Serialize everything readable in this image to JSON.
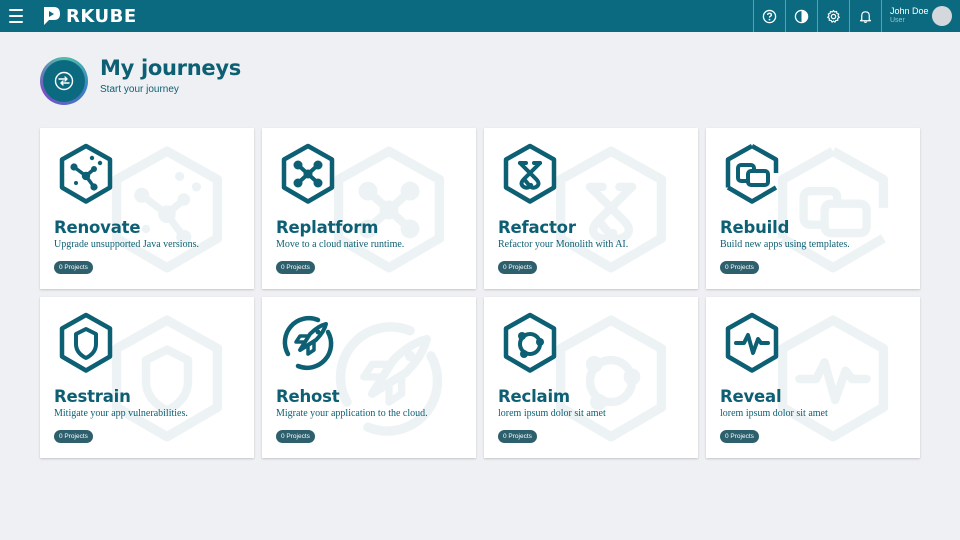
{
  "app": {
    "brand": "RKUBE",
    "brand_color": "#0b6a80"
  },
  "topbar": {
    "icons": [
      "help-icon",
      "contrast-icon",
      "gear-icon",
      "bell-icon"
    ],
    "user": {
      "name": "John Doe",
      "role": "User"
    }
  },
  "header": {
    "title": "My journeys",
    "subtitle": "Start your journey"
  },
  "journeys": [
    {
      "title": "Renovate",
      "description": "Upgrade unsupported Java versions.",
      "badge": "0 Projects",
      "icon": "renovate-icon"
    },
    {
      "title": "Replatform",
      "description": "Move to a cloud native runtime.",
      "badge": "0 Projects",
      "icon": "replatform-icon"
    },
    {
      "title": "Refactor",
      "description": "Refactor your Monolith with AI.",
      "badge": "0 Projects",
      "icon": "refactor-icon"
    },
    {
      "title": "Rebuild",
      "description": "Build new apps using templates.",
      "badge": "0 Projects",
      "icon": "rebuild-icon"
    },
    {
      "title": "Restrain",
      "description": "Mitigate your app vulnerabilities.",
      "badge": "0 Projects",
      "icon": "restrain-icon"
    },
    {
      "title": "Rehost",
      "description": "Migrate your application to the cloud.",
      "badge": "0 Projects",
      "icon": "rehost-icon"
    },
    {
      "title": "Reclaim",
      "description": "lorem ipsum dolor sit amet",
      "badge": "0 Projects",
      "icon": "reclaim-icon"
    },
    {
      "title": "Reveal",
      "description": "lorem ipsum dolor sit amet",
      "badge": "0 Projects",
      "icon": "reveal-icon"
    }
  ]
}
